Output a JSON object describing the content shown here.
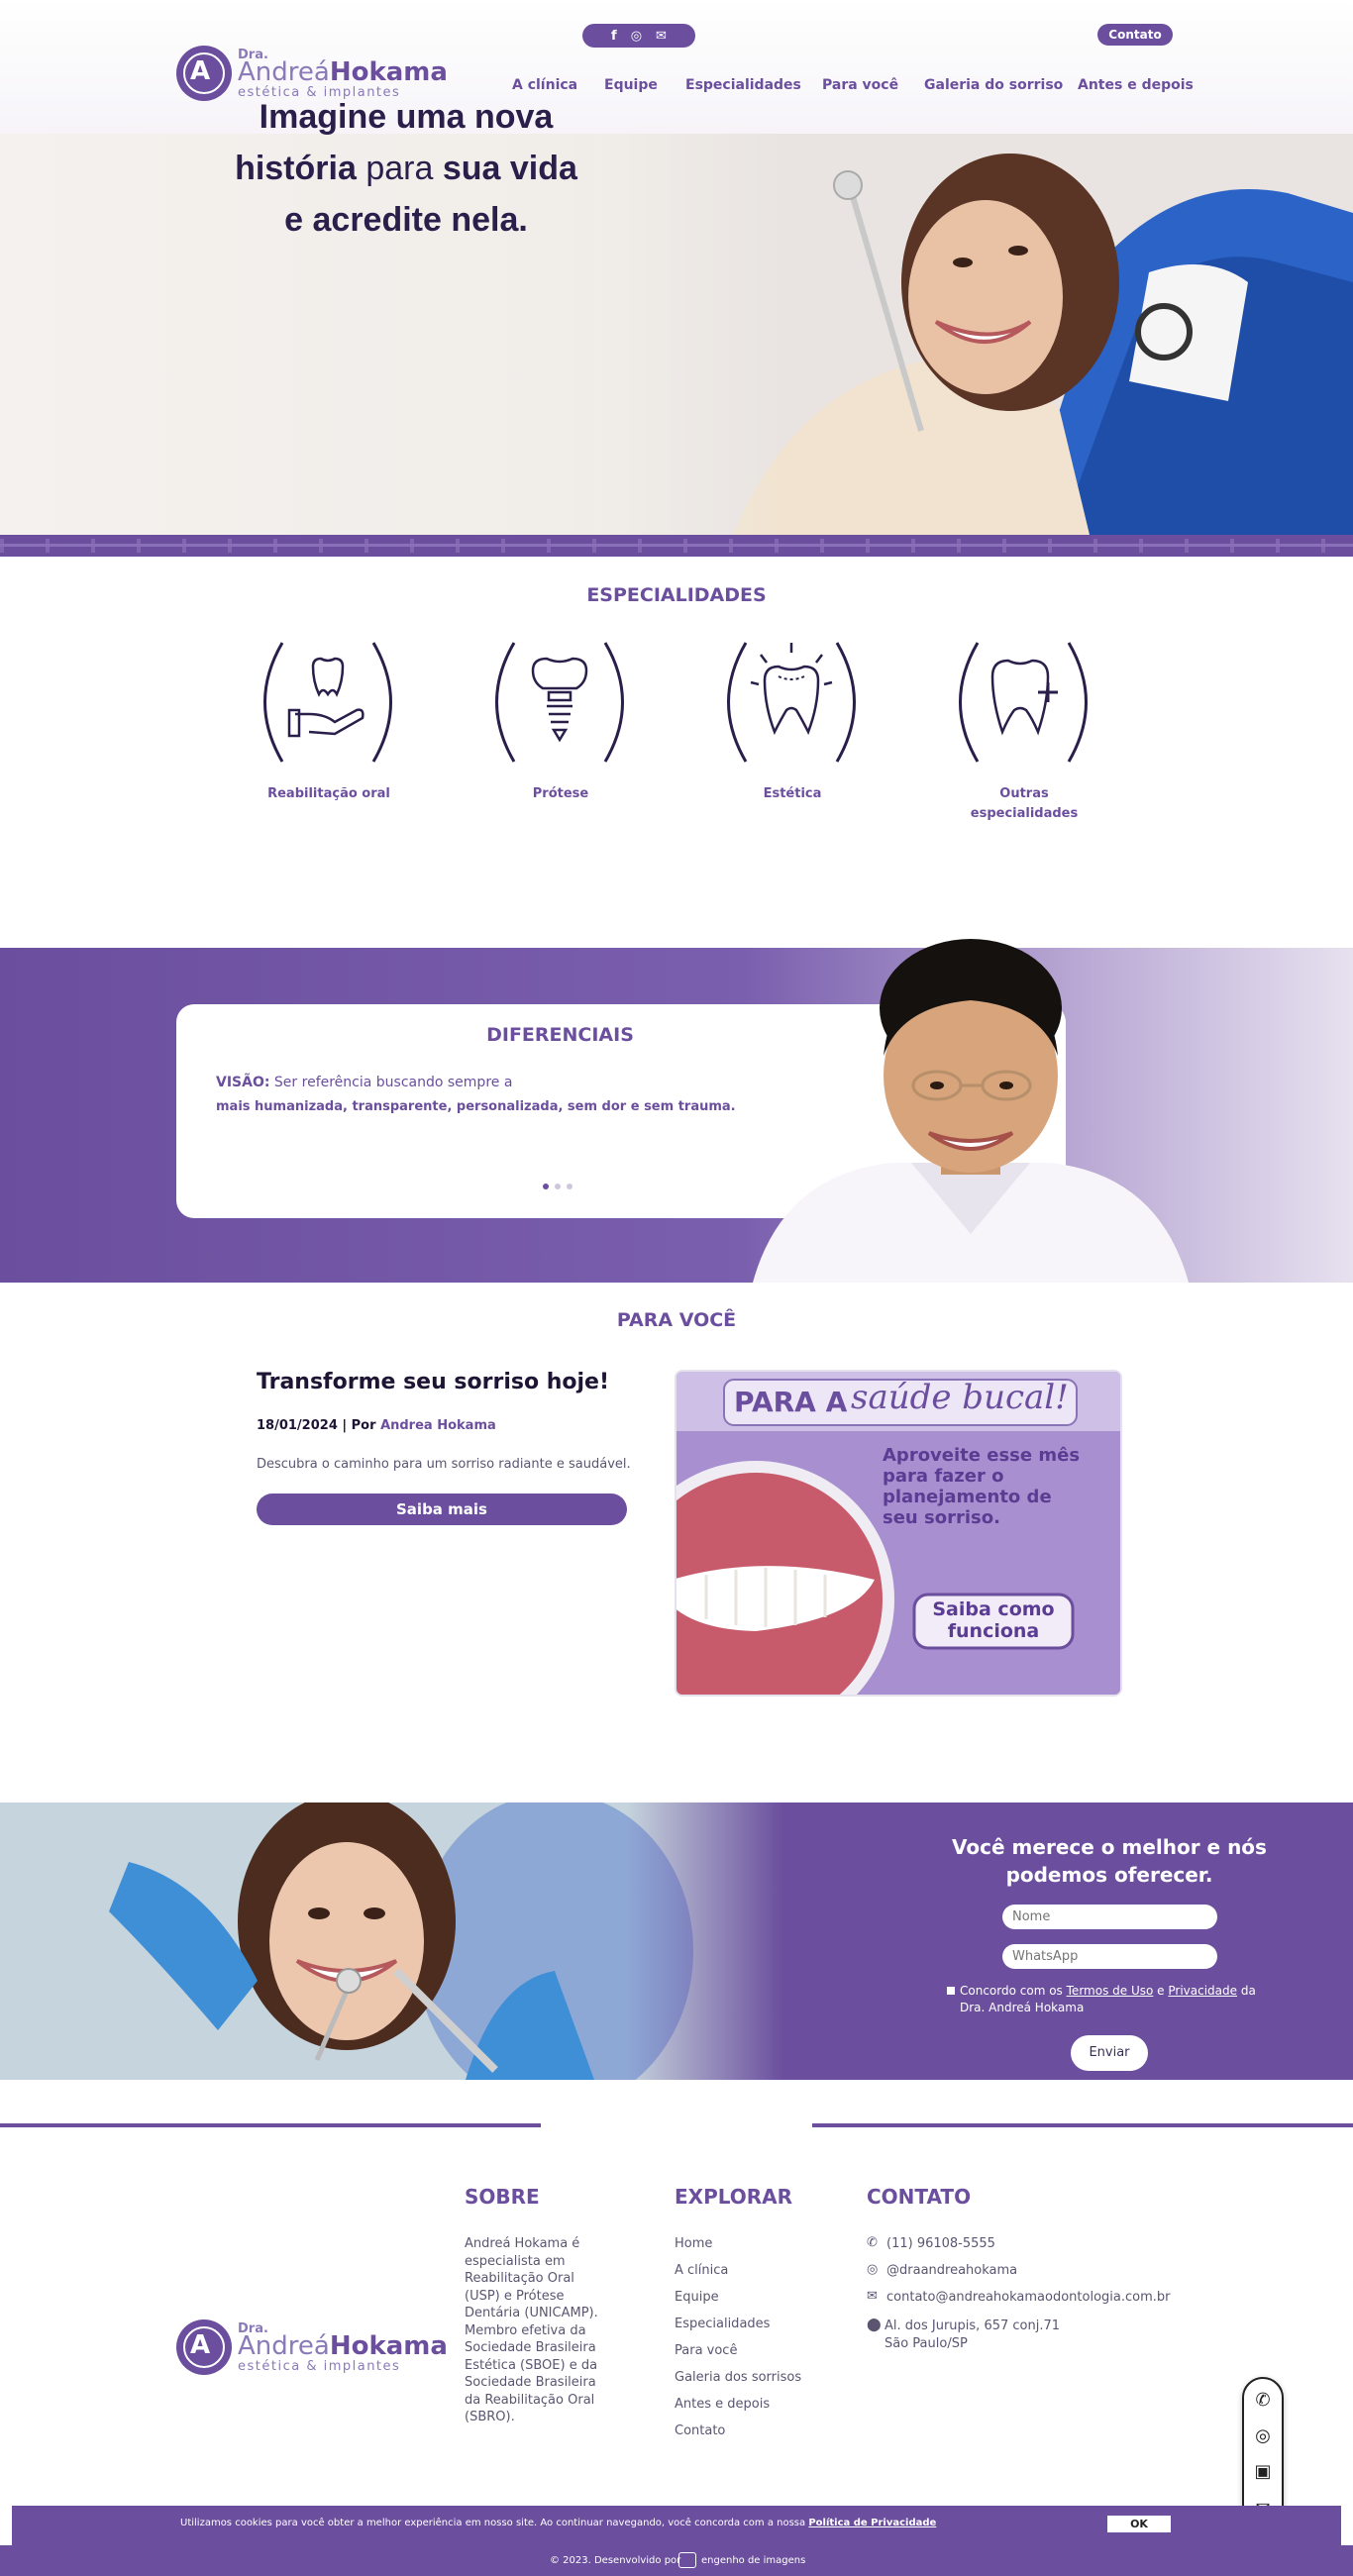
{
  "brand": {
    "dra": "Dra.",
    "name_light": "Andreá",
    "name_bold": "Hokama",
    "subtitle": "estética & implantes"
  },
  "header": {
    "social_icons": [
      "facebook-icon",
      "instagram-icon",
      "email-icon"
    ],
    "contato_label": "Contato",
    "nav": [
      "A clínica",
      "Equipe",
      "Especialidades",
      "Para você",
      "Galeria do sorriso",
      "Antes e depois"
    ]
  },
  "hero": {
    "line1": "Imagine uma nova",
    "line2_bold": "história",
    "line2_light": "para",
    "line2_bold2": "sua vida",
    "line3": "e acredite nela."
  },
  "especialidades": {
    "title": "ESPECIALIDADES",
    "items": [
      {
        "label": "Reabilitação oral",
        "icon": "hand-tooth-icon"
      },
      {
        "label": "Prótese",
        "icon": "implant-icon"
      },
      {
        "label": "Estética",
        "icon": "sparkle-tooth-icon"
      },
      {
        "label_line1": "Outras",
        "label_line2": "especialidades",
        "icon": "tooth-plus-icon"
      }
    ]
  },
  "diferenciais": {
    "title": "DIFERENCIAIS",
    "label": "VISÃO:",
    "text1": "Ser referência buscando sempre a",
    "text2": "mais humanizada, transparente, personalizada, sem dor e sem trauma.",
    "slides": 3,
    "active_slide": 1
  },
  "para_voce": {
    "title": "PARA VOCÊ",
    "post_title": "Transforme seu sorriso hoje!",
    "post_date": "18/01/2024 | Por",
    "post_author": "Andrea Hokama",
    "post_desc": "Descubra o caminho para um sorriso radiante e saudável.",
    "button": "Saiba mais",
    "promo": {
      "title_a": "PARA A",
      "title_b": "saúde bucal!",
      "text": [
        "Aproveite esse mês",
        "para fazer o",
        "planejamento de",
        "seu sorriso."
      ],
      "btn_line1": "Saiba como",
      "btn_line2": "funciona"
    }
  },
  "cta": {
    "title_line1": "Você merece o melhor e nós",
    "title_line2": "podemos oferecer.",
    "name_placeholder": "Nome",
    "whatsapp_placeholder": "WhatsApp",
    "terms_prefix": "Concordo com os",
    "terms_link": "Termos de Uso",
    "terms_and": "e",
    "privacy_link": "Privacidade",
    "terms_suffix": "da Dra. Andreá Hokama",
    "submit": "Enviar"
  },
  "footer": {
    "sobre_title": "SOBRE",
    "sobre_text": "Andreá Hokama é especialista em Reabilitação Oral (USP) e Prótese Dentária (UNICAMP). Membro efetiva da Sociedade Brasileira Estética (SBOE) e da Sociedade Brasileira da Reabilitação Oral (SBRO).",
    "explorar_title": "EXPLORAR",
    "explorar_links": [
      "Home",
      "A clínica",
      "Equipe",
      "Especialidades",
      "Para você",
      "Galeria dos sorrisos",
      "Antes e depois",
      "Contato"
    ],
    "contato_title": "CONTATO",
    "phone": "(11) 96108-5555",
    "instagram": "@draandreahokama",
    "email": "contato@andreahokamaodontologia.com.br",
    "address_line1": "Al. dos Jurupis, 657 conj.71",
    "address_line2": "São Paulo/SP"
  },
  "floating": [
    "whatsapp-icon",
    "instagram-icon",
    "facebook-icon",
    "email-icon"
  ],
  "cookie": {
    "text": "Utilizamos cookies para você obter a melhor experiência em nosso site. Ao continuar navegando, você concorda com a nossa",
    "link": "Política de Privacidade",
    "ok": "OK"
  },
  "bottom": {
    "copyright": "© 2023. Desenvolvido por",
    "developer": "engenho de imagens"
  },
  "colors": {
    "brand_purple": "#6b4f9e",
    "dark_text": "#2a1f4a",
    "light_purple": "#8a7ab8"
  }
}
